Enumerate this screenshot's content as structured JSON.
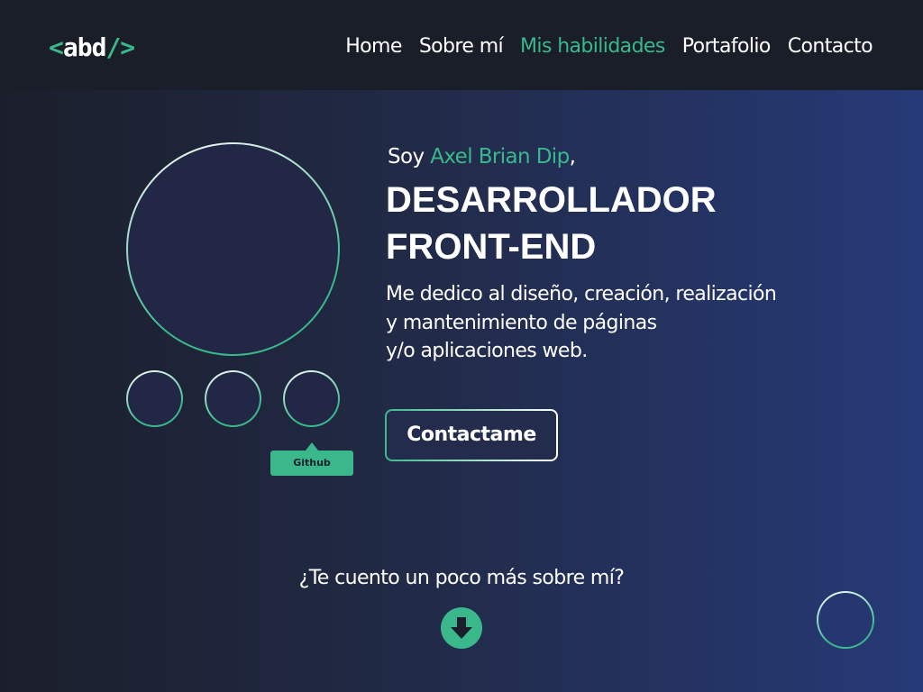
{
  "header": {
    "logo": {
      "open": "<",
      "text": "abd",
      "close": "/>"
    },
    "nav": [
      {
        "label": "Home"
      },
      {
        "label": "Sobre mí"
      },
      {
        "label": "Mis habilidades",
        "active": true
      },
      {
        "label": "Portafolio"
      },
      {
        "label": "Contacto"
      }
    ]
  },
  "hero": {
    "intro_prefix": "Soy ",
    "name": "Axel Brian Dip",
    "intro_suffix": ",",
    "title_lines": [
      "DESARROLLADOR",
      "FRONT-END"
    ],
    "description_lines": [
      "Me dedico al diseño, creación, realización",
      "y mantenimiento de páginas",
      "y/o aplicaciones web."
    ],
    "cta_label": "Contactame",
    "social_tooltip": "Github"
  },
  "footer": {
    "more_text": "¿Te cuento un poco más sobre mí?",
    "down_icon": "arrow-down-icon"
  },
  "colors": {
    "accent": "#3ab88c",
    "header_bg": "#1a1e29",
    "gradient_start": "#1b1f2b",
    "gradient_end": "#263a78"
  }
}
